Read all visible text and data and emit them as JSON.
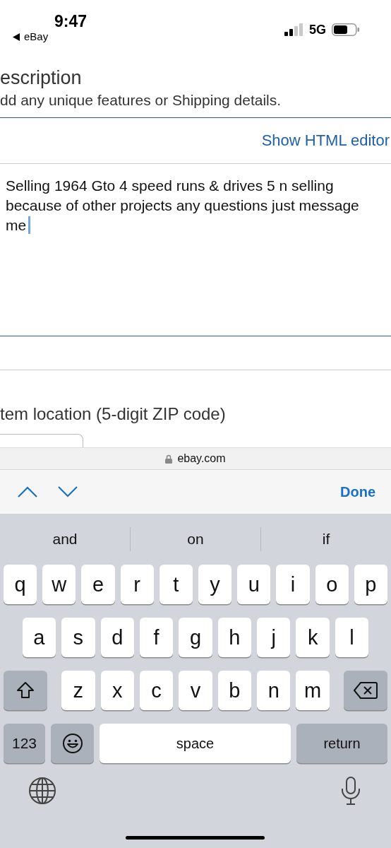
{
  "status_bar": {
    "time": "9:47",
    "back_label": "eBay",
    "network": "5G"
  },
  "description": {
    "label": "escription",
    "hint": "dd any unique features or Shipping details.",
    "editor_link": "Show HTML editor",
    "value": "Selling 1964 Gto 4 speed runs & drives 5 n selling because of other projects any questions just message me",
    "focused": true
  },
  "location": {
    "label": "tem location (5-digit ZIP code)"
  },
  "address_bar": {
    "domain": "ebay.com"
  },
  "form_accessory": {
    "done": "Done"
  },
  "keyboard": {
    "suggestions": [
      "and",
      "on",
      "if"
    ],
    "rows": [
      {
        "keys": [
          {
            "kind": "letter",
            "label": "q"
          },
          {
            "kind": "letter",
            "label": "w"
          },
          {
            "kind": "letter",
            "label": "e"
          },
          {
            "kind": "letter",
            "label": "r"
          },
          {
            "kind": "letter",
            "label": "t"
          },
          {
            "kind": "letter",
            "label": "y"
          },
          {
            "kind": "letter",
            "label": "u"
          },
          {
            "kind": "letter",
            "label": "i"
          },
          {
            "kind": "letter",
            "label": "o"
          },
          {
            "kind": "letter",
            "label": "p"
          }
        ]
      },
      {
        "keys": [
          {
            "kind": "letter",
            "label": "a"
          },
          {
            "kind": "letter",
            "label": "s"
          },
          {
            "kind": "letter",
            "label": "d"
          },
          {
            "kind": "letter",
            "label": "f"
          },
          {
            "kind": "letter",
            "label": "g"
          },
          {
            "kind": "letter",
            "label": "h"
          },
          {
            "kind": "letter",
            "label": "j"
          },
          {
            "kind": "letter",
            "label": "k"
          },
          {
            "kind": "letter",
            "label": "l"
          }
        ]
      },
      {
        "keys": [
          {
            "kind": "shift"
          },
          {
            "kind": "letter",
            "label": "z"
          },
          {
            "kind": "letter",
            "label": "x"
          },
          {
            "kind": "letter",
            "label": "c"
          },
          {
            "kind": "letter",
            "label": "v"
          },
          {
            "kind": "letter",
            "label": "b"
          },
          {
            "kind": "letter",
            "label": "n"
          },
          {
            "kind": "letter",
            "label": "m"
          },
          {
            "kind": "delete"
          }
        ]
      },
      {
        "keys": [
          {
            "kind": "mode",
            "label": "123"
          },
          {
            "kind": "emoji"
          },
          {
            "kind": "space",
            "label": "space"
          },
          {
            "kind": "return",
            "label": "return"
          }
        ]
      }
    ]
  }
}
